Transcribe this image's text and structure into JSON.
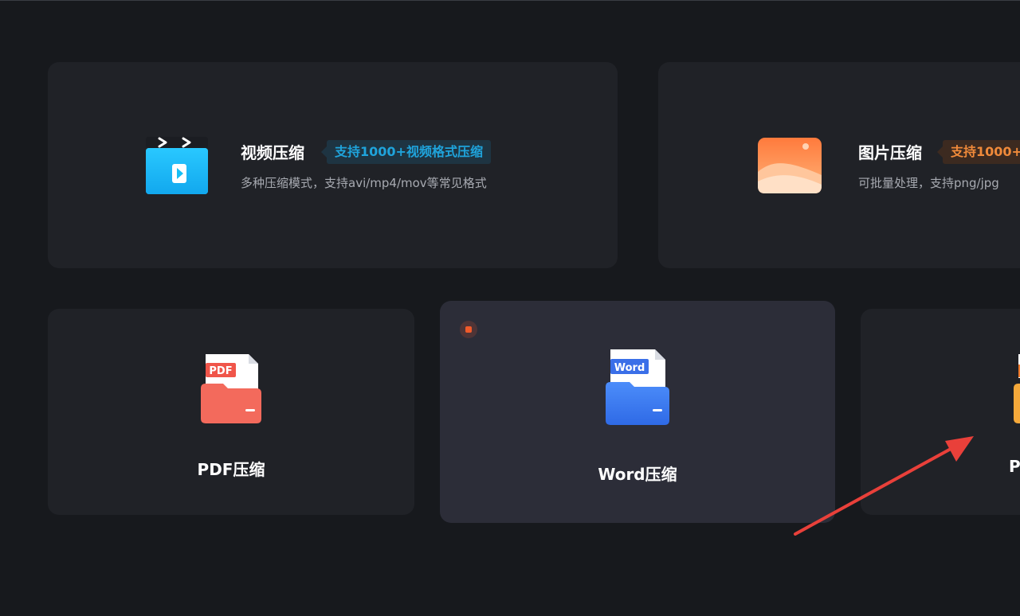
{
  "video": {
    "title": "视频压缩",
    "tag": "支持1000+视频格式压缩",
    "desc": "多种压缩模式，支持avi/mp4/mov等常见格式"
  },
  "image": {
    "title": "图片压缩",
    "tag": "支持1000+",
    "desc": "可批量处理，支持png/jpg"
  },
  "pdf": {
    "label": "PDF压缩",
    "badge": "PDF"
  },
  "word": {
    "label": "Word压缩",
    "badge": "Word"
  },
  "ppt": {
    "label": "P"
  },
  "colors": {
    "background": "#17191d",
    "card": "#202227",
    "card_selected": "#2c2d38",
    "video_accent": "#1fa4dc",
    "image_accent": "#f08a3a",
    "pdf_red": "#f0554a",
    "word_blue": "#3a7ef0",
    "annotation_arrow": "#e9403a"
  }
}
